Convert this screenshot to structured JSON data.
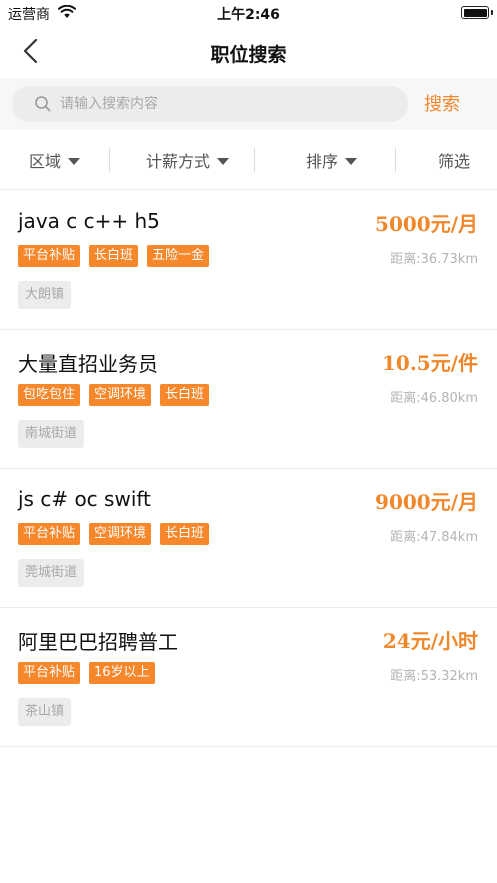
{
  "status_bar": {
    "carrier": "运营商",
    "time": "上午2:46"
  },
  "nav": {
    "title": "职位搜索"
  },
  "search": {
    "placeholder": "请输入搜索内容",
    "value": "",
    "button_label": "搜索"
  },
  "filters": {
    "area": "区域",
    "salary_type": "计薪方式",
    "sort": "排序",
    "filter": "筛选"
  },
  "colors": {
    "accent": "#f0872b",
    "tag_bg": "#f6872b",
    "location_bg": "#ececec"
  },
  "jobs": [
    {
      "title": "java c c++ h5",
      "salary": "5000元/月",
      "tags": [
        "平台补贴",
        "长白班",
        "五险一金"
      ],
      "distance": "距离:36.73km",
      "location": "大朗镇"
    },
    {
      "title": "大量直招业务员",
      "salary": "10.5元/件",
      "tags": [
        "包吃包住",
        "空调环境",
        "长白班"
      ],
      "distance": "距离:46.80km",
      "location": "南城街道"
    },
    {
      "title": "js c# oc swift",
      "salary": "9000元/月",
      "tags": [
        "平台补贴",
        "空调环境",
        "长白班"
      ],
      "distance": "距离:47.84km",
      "location": "莞城街道"
    },
    {
      "title": "阿里巴巴招聘普工",
      "salary": "24元/小时",
      "tags": [
        "平台补贴",
        "16岁以上"
      ],
      "distance": "距离:53.32km",
      "location": "茶山镇"
    }
  ]
}
